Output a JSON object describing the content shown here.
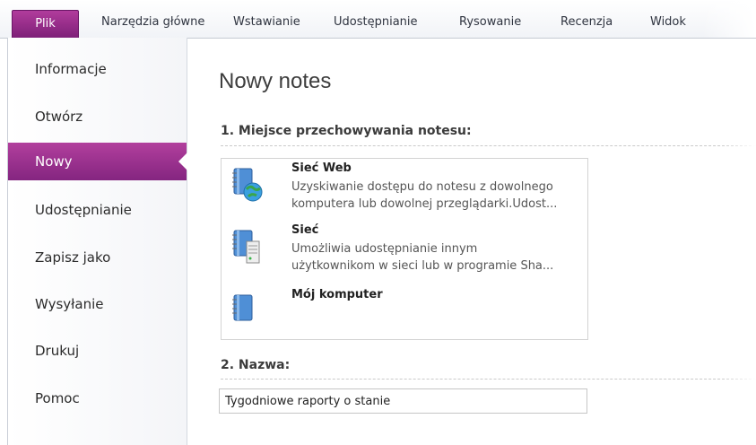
{
  "ribbon": {
    "tabs": [
      {
        "label": "Plik",
        "active": true
      },
      {
        "label": "Narzędzia główne"
      },
      {
        "label": "Wstawianie"
      },
      {
        "label": "Udostępnianie"
      },
      {
        "label": "Rysowanie"
      },
      {
        "label": "Recenzja"
      },
      {
        "label": "Widok"
      }
    ]
  },
  "nav": {
    "items": [
      {
        "label": "Informacje"
      },
      {
        "label": "Otwórz"
      },
      {
        "label": "Nowy",
        "selected": true
      },
      {
        "label": "Udostępnianie"
      },
      {
        "label": "Zapisz jako"
      },
      {
        "label": "Wysyłanie"
      },
      {
        "label": "Drukuj"
      },
      {
        "label": "Pomoc"
      }
    ]
  },
  "main": {
    "title": "Nowy notes",
    "section_location": "1. Miejsce przechowywania notesu:",
    "locations": [
      {
        "title": "Sieć Web",
        "desc_lines": [
          "Uzyskiwanie dostępu do notesu z dowolnego",
          "komputera lub dowolnej przeglądarki.Udost..."
        ],
        "icon": "web-notebook-icon"
      },
      {
        "title": "Sieć",
        "desc_lines": [
          "Umożliwia udostępnianie innym",
          "użytkownikom w sieci lub w programie Sha..."
        ],
        "icon": "network-notebook-icon"
      },
      {
        "title": "Mój komputer",
        "desc_lines": [],
        "icon": "computer-notebook-icon"
      }
    ],
    "section_name": "2. Nazwa:",
    "name_value": "Tygodniowe raporty o stanie"
  },
  "colors": {
    "accent": "#9b2f8f",
    "accent_dark": "#7c1f77"
  }
}
